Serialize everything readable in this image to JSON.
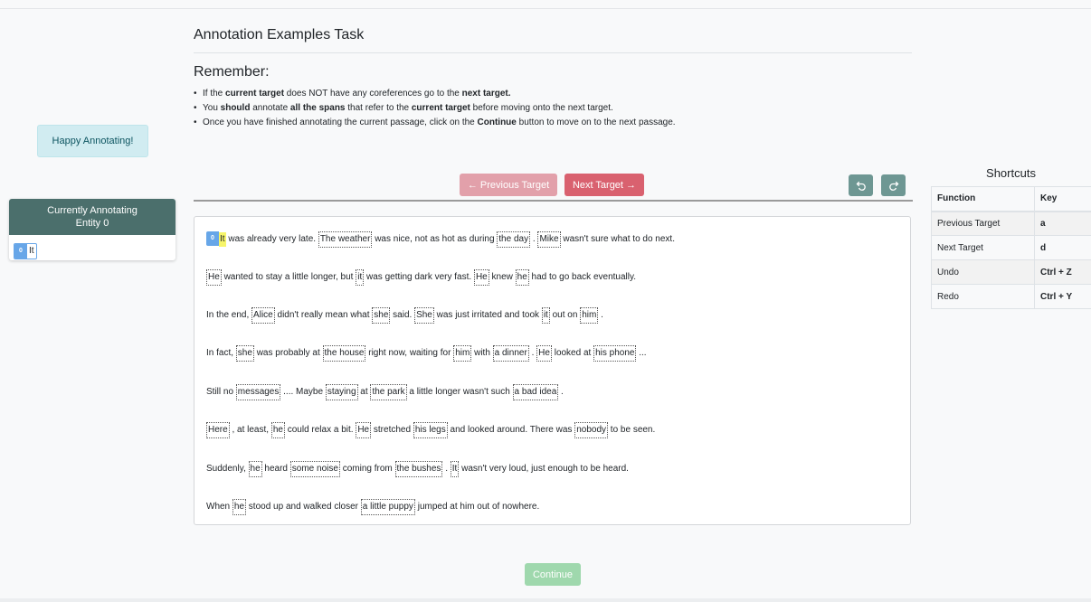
{
  "sidebar": {
    "happy_text": "Happy Annotating!",
    "currently_line1": "Currently Annotating",
    "currently_line2": "Entity 0",
    "entity_chip": {
      "index": "0",
      "text": "It"
    }
  },
  "main": {
    "task_title": "Annotation Examples Task",
    "remember_heading": "Remember:",
    "rules": [
      {
        "a": "If the ",
        "b": "current target",
        "c": " does NOT have any coreferences go to the ",
        "d": "next target.",
        "e": ""
      },
      {
        "a": "You ",
        "b": "should",
        "c": " annotate ",
        "d": "all the spans",
        "e": " that refer to the ",
        "f": "current target",
        "g": " before moving onto the next target."
      },
      {
        "a": "Once you have finished annotating the current passage, click on the ",
        "b": "Continue",
        "c": " button to move on to the next passage."
      }
    ],
    "buttons": {
      "previous_target": "← Previous Target",
      "next_target": "Next Target →",
      "continue": "Continue"
    }
  },
  "passage": {
    "current_badge": "0",
    "lines": [
      [
        {
          "t": "It",
          "cur": true
        },
        {
          "t": " was already very late. "
        },
        {
          "t": "The weather",
          "m": true
        },
        {
          "t": " was nice, not as hot as during "
        },
        {
          "t": "the day",
          "m": true
        },
        {
          "t": " . "
        },
        {
          "t": "Mike",
          "m": true
        },
        {
          "t": " wasn't sure what to do next."
        }
      ],
      [
        {
          "t": "He",
          "m": true
        },
        {
          "t": " wanted to stay a little longer, but "
        },
        {
          "t": "it",
          "m": true
        },
        {
          "t": " was getting dark very fast. "
        },
        {
          "t": "He",
          "m": true
        },
        {
          "t": " knew "
        },
        {
          "t": "he",
          "m": true
        },
        {
          "t": " had to go back eventually."
        }
      ],
      [
        {
          "t": "In the end, "
        },
        {
          "t": "Alice",
          "m": true
        },
        {
          "t": " didn't really mean what "
        },
        {
          "t": "she",
          "m": true
        },
        {
          "t": " said. "
        },
        {
          "t": "She",
          "m": true
        },
        {
          "t": " was just irritated and took "
        },
        {
          "t": "it",
          "m": true
        },
        {
          "t": " out on "
        },
        {
          "t": "him",
          "m": true
        },
        {
          "t": " ."
        }
      ],
      [
        {
          "t": "In fact, "
        },
        {
          "t": "she",
          "m": true
        },
        {
          "t": " was probably at "
        },
        {
          "t": "the house",
          "m": true
        },
        {
          "t": " right now, waiting for "
        },
        {
          "t": "him",
          "m": true
        },
        {
          "t": " with "
        },
        {
          "t": "a dinner",
          "m": true
        },
        {
          "t": " . "
        },
        {
          "t": "He",
          "m": true
        },
        {
          "t": " looked at "
        },
        {
          "t": "his phone",
          "m": true
        },
        {
          "t": " ..."
        }
      ],
      [
        {
          "t": "Still no "
        },
        {
          "t": "messages",
          "m": true
        },
        {
          "t": " .... Maybe "
        },
        {
          "t": "staying",
          "m": true
        },
        {
          "t": " at "
        },
        {
          "t": "the park",
          "m": true
        },
        {
          "t": " a little longer wasn't such "
        },
        {
          "t": "a bad idea",
          "m": true
        },
        {
          "t": " ."
        }
      ],
      [
        {
          "t": "Here",
          "m": true
        },
        {
          "t": " , at least, "
        },
        {
          "t": "he",
          "m": true
        },
        {
          "t": " could relax a bit. "
        },
        {
          "t": "He",
          "m": true
        },
        {
          "t": " stretched "
        },
        {
          "t": "his legs",
          "m": true
        },
        {
          "t": " and looked around. There was "
        },
        {
          "t": "nobody",
          "m": true
        },
        {
          "t": " to be seen."
        }
      ],
      [
        {
          "t": "Suddenly, "
        },
        {
          "t": "he",
          "m": true
        },
        {
          "t": " heard "
        },
        {
          "t": "some noise",
          "m": true
        },
        {
          "t": " coming from "
        },
        {
          "t": "the bushes",
          "m": true
        },
        {
          "t": " . "
        },
        {
          "t": "It",
          "m": true
        },
        {
          "t": " wasn't very loud, just enough to be heard."
        }
      ],
      [
        {
          "t": "When "
        },
        {
          "t": "he",
          "m": true
        },
        {
          "t": " stood up and walked closer "
        },
        {
          "t": "a little puppy",
          "m": true
        },
        {
          "t": " jumped at him out of nowhere."
        }
      ]
    ]
  },
  "shortcuts": {
    "title": "Shortcuts",
    "headers": {
      "function": "Function",
      "key": "Key"
    },
    "rows": [
      {
        "function": "Previous Target",
        "key": "a"
      },
      {
        "function": "Next Target",
        "key": "d"
      },
      {
        "function": "Undo",
        "key": "Ctrl + Z"
      },
      {
        "function": "Redo",
        "key": "Ctrl + Y"
      }
    ]
  },
  "colors": {
    "accent_teal": "#4b6f6c",
    "next_button": "#d9616f",
    "current_highlight": "#f7f56a",
    "entity_badge": "#67a6e8"
  }
}
